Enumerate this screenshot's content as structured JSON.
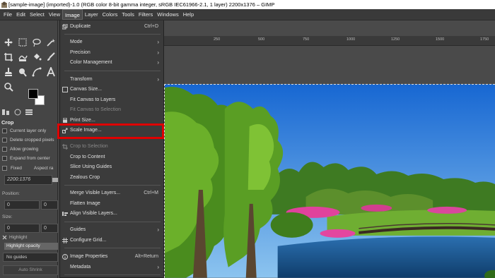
{
  "titlebar": {
    "text": "[sample-image] (imported)-1.0 (RGB color 8-bit gamma integer, sRGB IEC61966-2.1, 1 layer) 2200x1376 – GIMP"
  },
  "menubar": {
    "items": [
      "File",
      "Edit",
      "Select",
      "View",
      "Image",
      "Layer",
      "Colors",
      "Tools",
      "Filters",
      "Windows",
      "Help"
    ],
    "active_index": 4
  },
  "tool_options": {
    "title": "Crop",
    "current_layer_only": "Current layer only",
    "delete_cropped": "Delete cropped pixels",
    "allow_growing": "Allow growing",
    "expand_from_center": "Expand from center",
    "fixed": "Fixed",
    "aspect": "Aspect ra",
    "ratio_value": "2200:1376",
    "position_label": "Position:",
    "pos_x": "0",
    "pos_y": "0",
    "size_label": "Size:",
    "size_w": "0",
    "size_h": "0",
    "highlight": "Highlight",
    "highlight_opacity": "Highlight opacity",
    "guides": "No guides",
    "auto_shrink": "Auto Shrink"
  },
  "image_menu": {
    "duplicate": {
      "label": "Duplicate",
      "shortcut": "Ctrl+D"
    },
    "mode": "Mode",
    "precision": "Precision",
    "color_management": "Color Management",
    "transform": "Transform",
    "canvas_size": "Canvas Size...",
    "fit_canvas_layers": "Fit Canvas to Layers",
    "fit_canvas_selection": "Fit Canvas to Selection",
    "print_size": "Print Size...",
    "scale_image": "Scale Image...",
    "crop_to_selection": "Crop to Selection",
    "crop_to_content": "Crop to Content",
    "slice_guides": "Slice Using Guides",
    "zealous_crop": "Zealous Crop",
    "merge_visible": {
      "label": "Merge Visible Layers...",
      "shortcut": "Ctrl+M"
    },
    "flatten": "Flatten Image",
    "align_visible": "Align Visible Layers...",
    "guides": "Guides",
    "configure_grid": "Configure Grid...",
    "image_properties": {
      "label": "Image Properties",
      "shortcut": "Alt+Return"
    },
    "metadata": "Metadata"
  },
  "ruler": {
    "ticks": [
      "250",
      "500",
      "750",
      "1000",
      "1250",
      "1500",
      "1750"
    ]
  },
  "colors": {
    "highlight_box": "#e00000",
    "sky_top": "#1a6fd6",
    "sky_bottom": "#8ec3ee"
  }
}
